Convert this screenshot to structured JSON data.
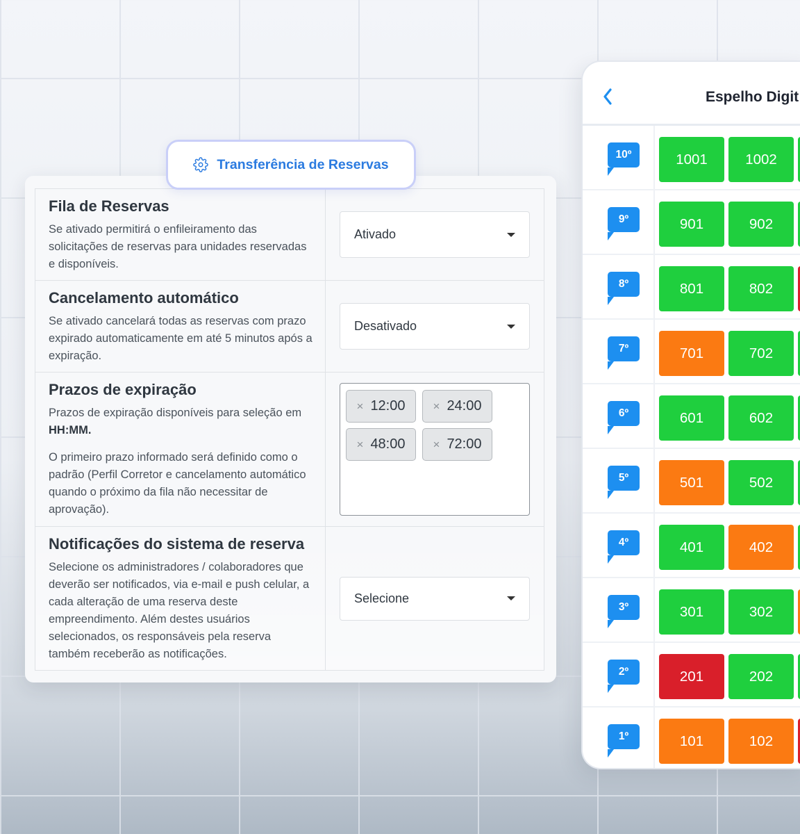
{
  "tab": {
    "label": "Transferência de Reservas",
    "icon": "gear-icon"
  },
  "settings": [
    {
      "title": "Fila de Reservas",
      "desc": "Se ativado permitirá o enfileiramento das solicitações de reservas para unidades reservadas e disponíveis.",
      "select_value": "Ativado"
    },
    {
      "title": "Cancelamento automático",
      "desc": "Se ativado cancelará todas as reservas com prazo expirado automaticamente em até 5 minutos após a expiração.",
      "select_value": "Desativado"
    },
    {
      "title": "Prazos de expiração",
      "desc_prefix": "Prazos de expiração disponíveis para seleção em ",
      "desc_bold": "HH:MM.",
      "desc2": "O primeiro prazo informado será definido como o padrão (Perfil Corretor e cancelamento automático quando o próximo da fila não necessitar de aprovação).",
      "tags": [
        "12:00",
        "24:00",
        "48:00",
        "72:00"
      ],
      "tag_remove": "×"
    },
    {
      "title": "Notificações do sistema de reserva",
      "desc": "Selecione os administradores / colaboradores que deverão ser notificados, via e-mail e push celular, a cada alteração de uma reserva deste empreendimento. Além destes usuários selecionados, os responsáveis pela reserva também receberão as notificações.",
      "select_value": "Selecione"
    }
  ],
  "phone": {
    "title": "Espelho Digit",
    "back_icon": "chevron-left-icon",
    "colors": {
      "green": "#1fcf3e",
      "orange": "#fb7a12",
      "red": "#d91f2a",
      "flag": "#1d8ff0"
    },
    "floors": [
      {
        "label": "10º",
        "units": [
          {
            "n": "1001",
            "c": "green"
          },
          {
            "n": "1002",
            "c": "green"
          }
        ],
        "next": "green"
      },
      {
        "label": "9º",
        "units": [
          {
            "n": "901",
            "c": "green"
          },
          {
            "n": "902",
            "c": "green"
          }
        ],
        "next": "green"
      },
      {
        "label": "8º",
        "units": [
          {
            "n": "801",
            "c": "green"
          },
          {
            "n": "802",
            "c": "green"
          }
        ],
        "next": "red"
      },
      {
        "label": "7º",
        "units": [
          {
            "n": "701",
            "c": "orange"
          },
          {
            "n": "702",
            "c": "green"
          }
        ],
        "next": "green"
      },
      {
        "label": "6º",
        "units": [
          {
            "n": "601",
            "c": "green"
          },
          {
            "n": "602",
            "c": "green"
          }
        ],
        "next": "green"
      },
      {
        "label": "5º",
        "units": [
          {
            "n": "501",
            "c": "orange"
          },
          {
            "n": "502",
            "c": "green"
          }
        ],
        "next": "green"
      },
      {
        "label": "4º",
        "units": [
          {
            "n": "401",
            "c": "green"
          },
          {
            "n": "402",
            "c": "orange"
          }
        ],
        "next": "green"
      },
      {
        "label": "3º",
        "units": [
          {
            "n": "301",
            "c": "green"
          },
          {
            "n": "302",
            "c": "green"
          }
        ],
        "next": "orange"
      },
      {
        "label": "2º",
        "units": [
          {
            "n": "201",
            "c": "red"
          },
          {
            "n": "202",
            "c": "green"
          }
        ],
        "next": "green"
      },
      {
        "label": "1º",
        "units": [
          {
            "n": "101",
            "c": "orange"
          },
          {
            "n": "102",
            "c": "orange"
          }
        ],
        "next": "red"
      }
    ]
  }
}
